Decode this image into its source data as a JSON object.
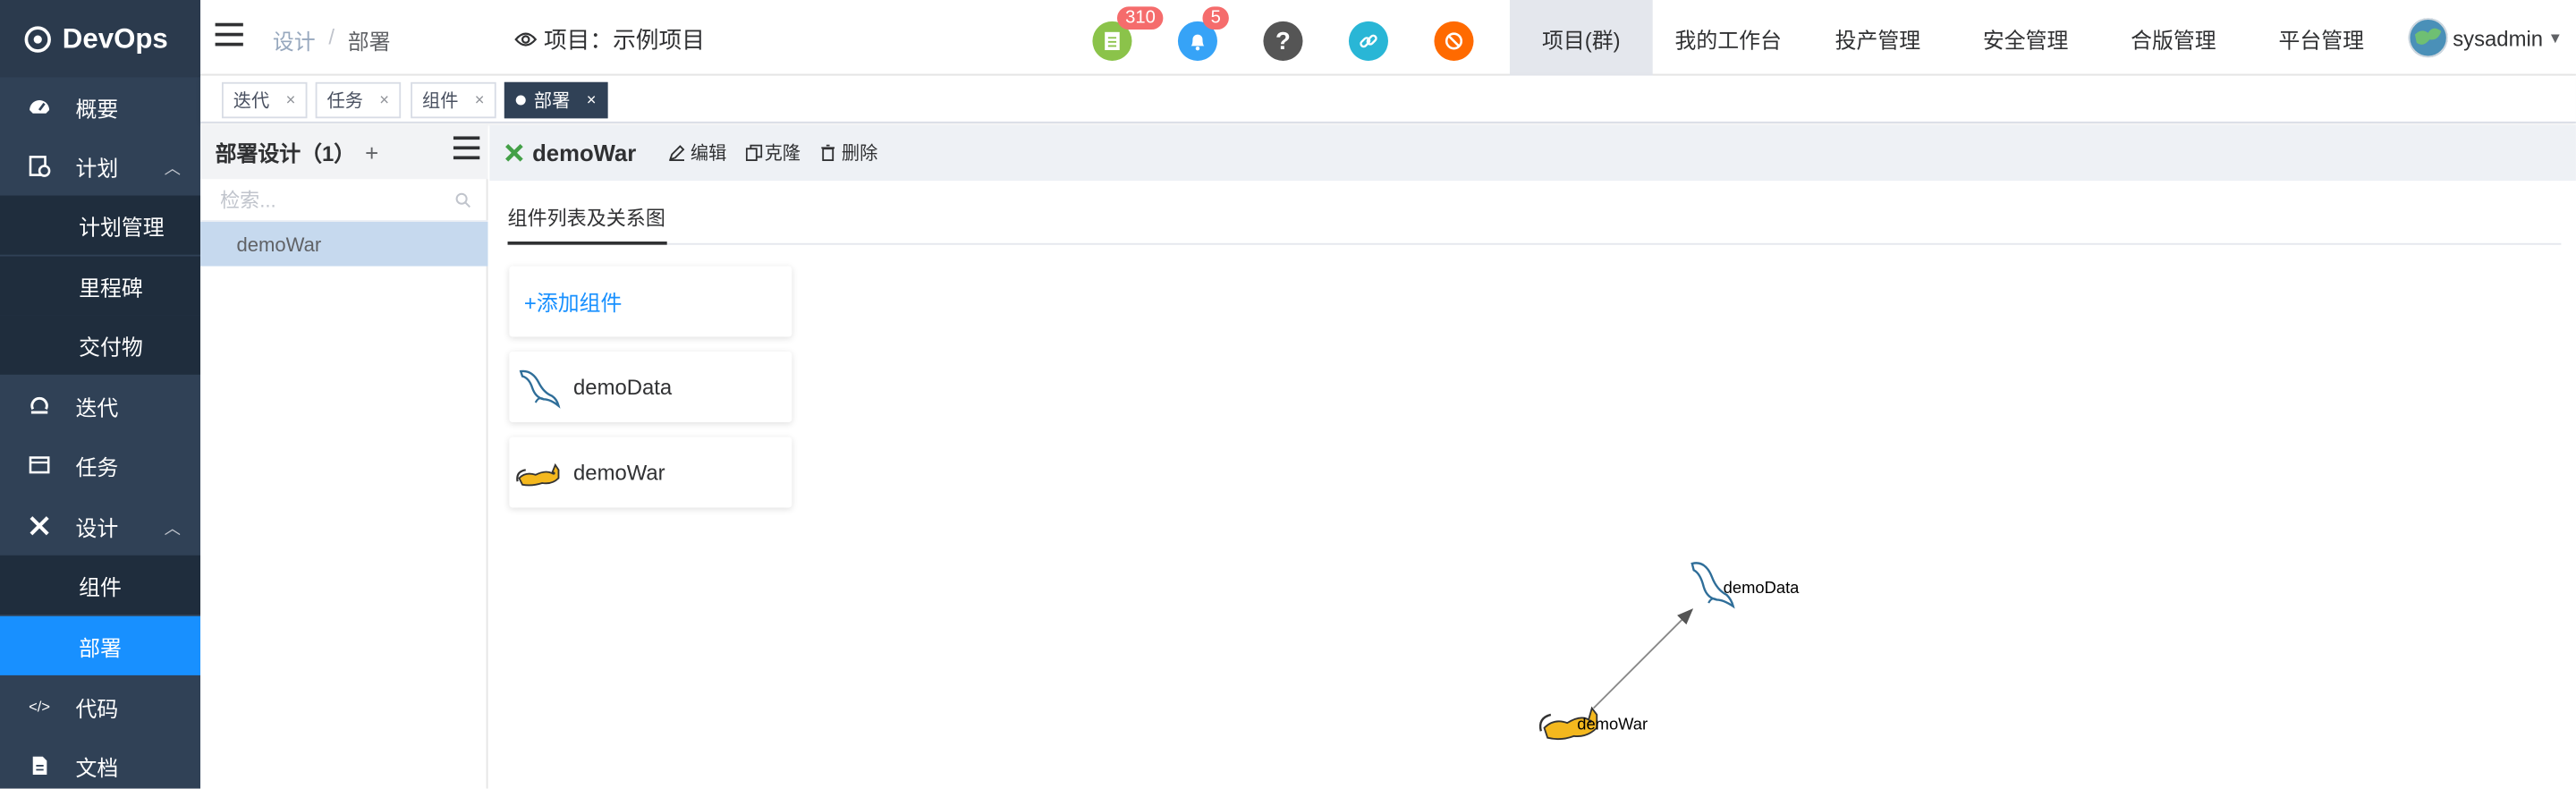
{
  "app": {
    "logo_text": "DevOps"
  },
  "sidebar": {
    "items": [
      {
        "label": "概要"
      },
      {
        "label": "计划",
        "children": [
          "计划管理",
          "里程碑",
          "交付物"
        ]
      },
      {
        "label": "迭代"
      },
      {
        "label": "任务"
      },
      {
        "label": "设计",
        "children": [
          "组件",
          "部署"
        ]
      },
      {
        "label": "代码"
      },
      {
        "label": "文档"
      }
    ],
    "active": "部署"
  },
  "header": {
    "breadcrumb": [
      "设计",
      "部署"
    ],
    "breadcrumb_sep": "/",
    "project_label": "项目：示例项目",
    "badges": {
      "todo_count": "310",
      "notify_count": "5"
    },
    "icon_colors": {
      "todo": "#8bc34a",
      "notify": "#36a3f7",
      "help": "#555555",
      "link": "#29b6d6",
      "block": "#ff6a00"
    },
    "nav": [
      "项目(群)",
      "我的工作台",
      "投产管理",
      "安全管理",
      "合版管理",
      "平台管理"
    ],
    "active_nav": "项目(群)",
    "user": "sysadmin"
  },
  "tags": [
    {
      "label": "迭代",
      "close": "×"
    },
    {
      "label": "任务",
      "close": "×"
    },
    {
      "label": "组件",
      "close": "×"
    },
    {
      "label": "部署",
      "close": "×",
      "active": true
    }
  ],
  "left_panel": {
    "title": "部署设计（1）",
    "add": "+",
    "search_placeholder": "检索...",
    "items": [
      "demoWar"
    ]
  },
  "main": {
    "title": "demoWar",
    "actions": [
      "编辑",
      "克隆",
      "删除"
    ],
    "tab": "组件列表及关系图",
    "add_component": "+添加组件",
    "components": [
      {
        "name": "demoData",
        "icon": "mysql-dolphin-icon"
      },
      {
        "name": "demoWar",
        "icon": "tomcat-icon"
      }
    ],
    "graph": {
      "nodes": [
        {
          "label": "demoData",
          "icon": "mysql-dolphin-icon"
        },
        {
          "label": "demoWar",
          "icon": "tomcat-icon"
        }
      ],
      "edges": [
        {
          "from": "demoWar",
          "to": "demoData"
        }
      ]
    }
  },
  "colors": {
    "sidebar_bg": "#304156",
    "sidebar_active": "#1890ff",
    "accent": "#1890ff",
    "selected_item": "#c6d9ee"
  }
}
